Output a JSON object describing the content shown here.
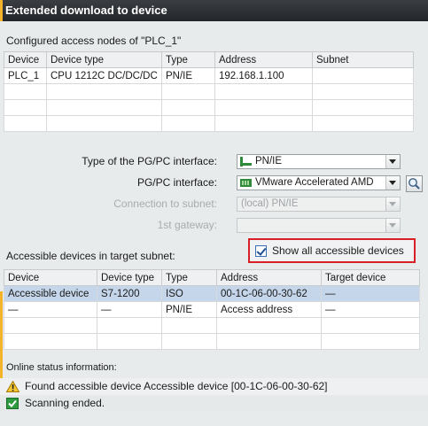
{
  "window": {
    "title": "Extended download to device"
  },
  "configured": {
    "heading": "Configured access nodes of \"PLC_1\"",
    "columns": [
      "Device",
      "Device type",
      "Type",
      "Address",
      "Subnet"
    ],
    "rows": [
      [
        "PLC_1",
        "CPU 1212C DC/DC/DC",
        "PN/IE",
        "192.168.1.100",
        ""
      ]
    ]
  },
  "interface": {
    "type_label": "Type of the PG/PC interface:",
    "type_value": "PN/IE",
    "pgpc_label": "PG/PC interface:",
    "pgpc_value": "VMware Accelerated AMD",
    "subnet_label": "Connection to subnet:",
    "subnet_value": "(local) PN/IE",
    "gateway_label": "1st gateway:",
    "gateway_value": ""
  },
  "accessible": {
    "heading": "Accessible devices in target subnet:",
    "show_all_label": "Show all accessible devices",
    "show_all_checked": true,
    "columns": [
      "Device",
      "Device type",
      "Type",
      "Address",
      "Target device"
    ],
    "rows": [
      [
        "Accessible device",
        "S7-1200",
        "ISO",
        "00-1C-06-00-30-62",
        "—"
      ],
      [
        "—",
        "—",
        "PN/IE",
        "Access address",
        "—"
      ]
    ]
  },
  "online_status": {
    "heading": "Online status information:",
    "messages": [
      {
        "icon": "warning-icon",
        "text": "Found accessible device Accessible device [00-1C-06-00-30-62]"
      },
      {
        "icon": "check-icon",
        "text": "Scanning ended."
      }
    ]
  },
  "colors": {
    "title_bg": "#2b2f32",
    "accent": "#f3b32b",
    "highlight": "#d91f26",
    "selection": "#c5d6ea"
  }
}
